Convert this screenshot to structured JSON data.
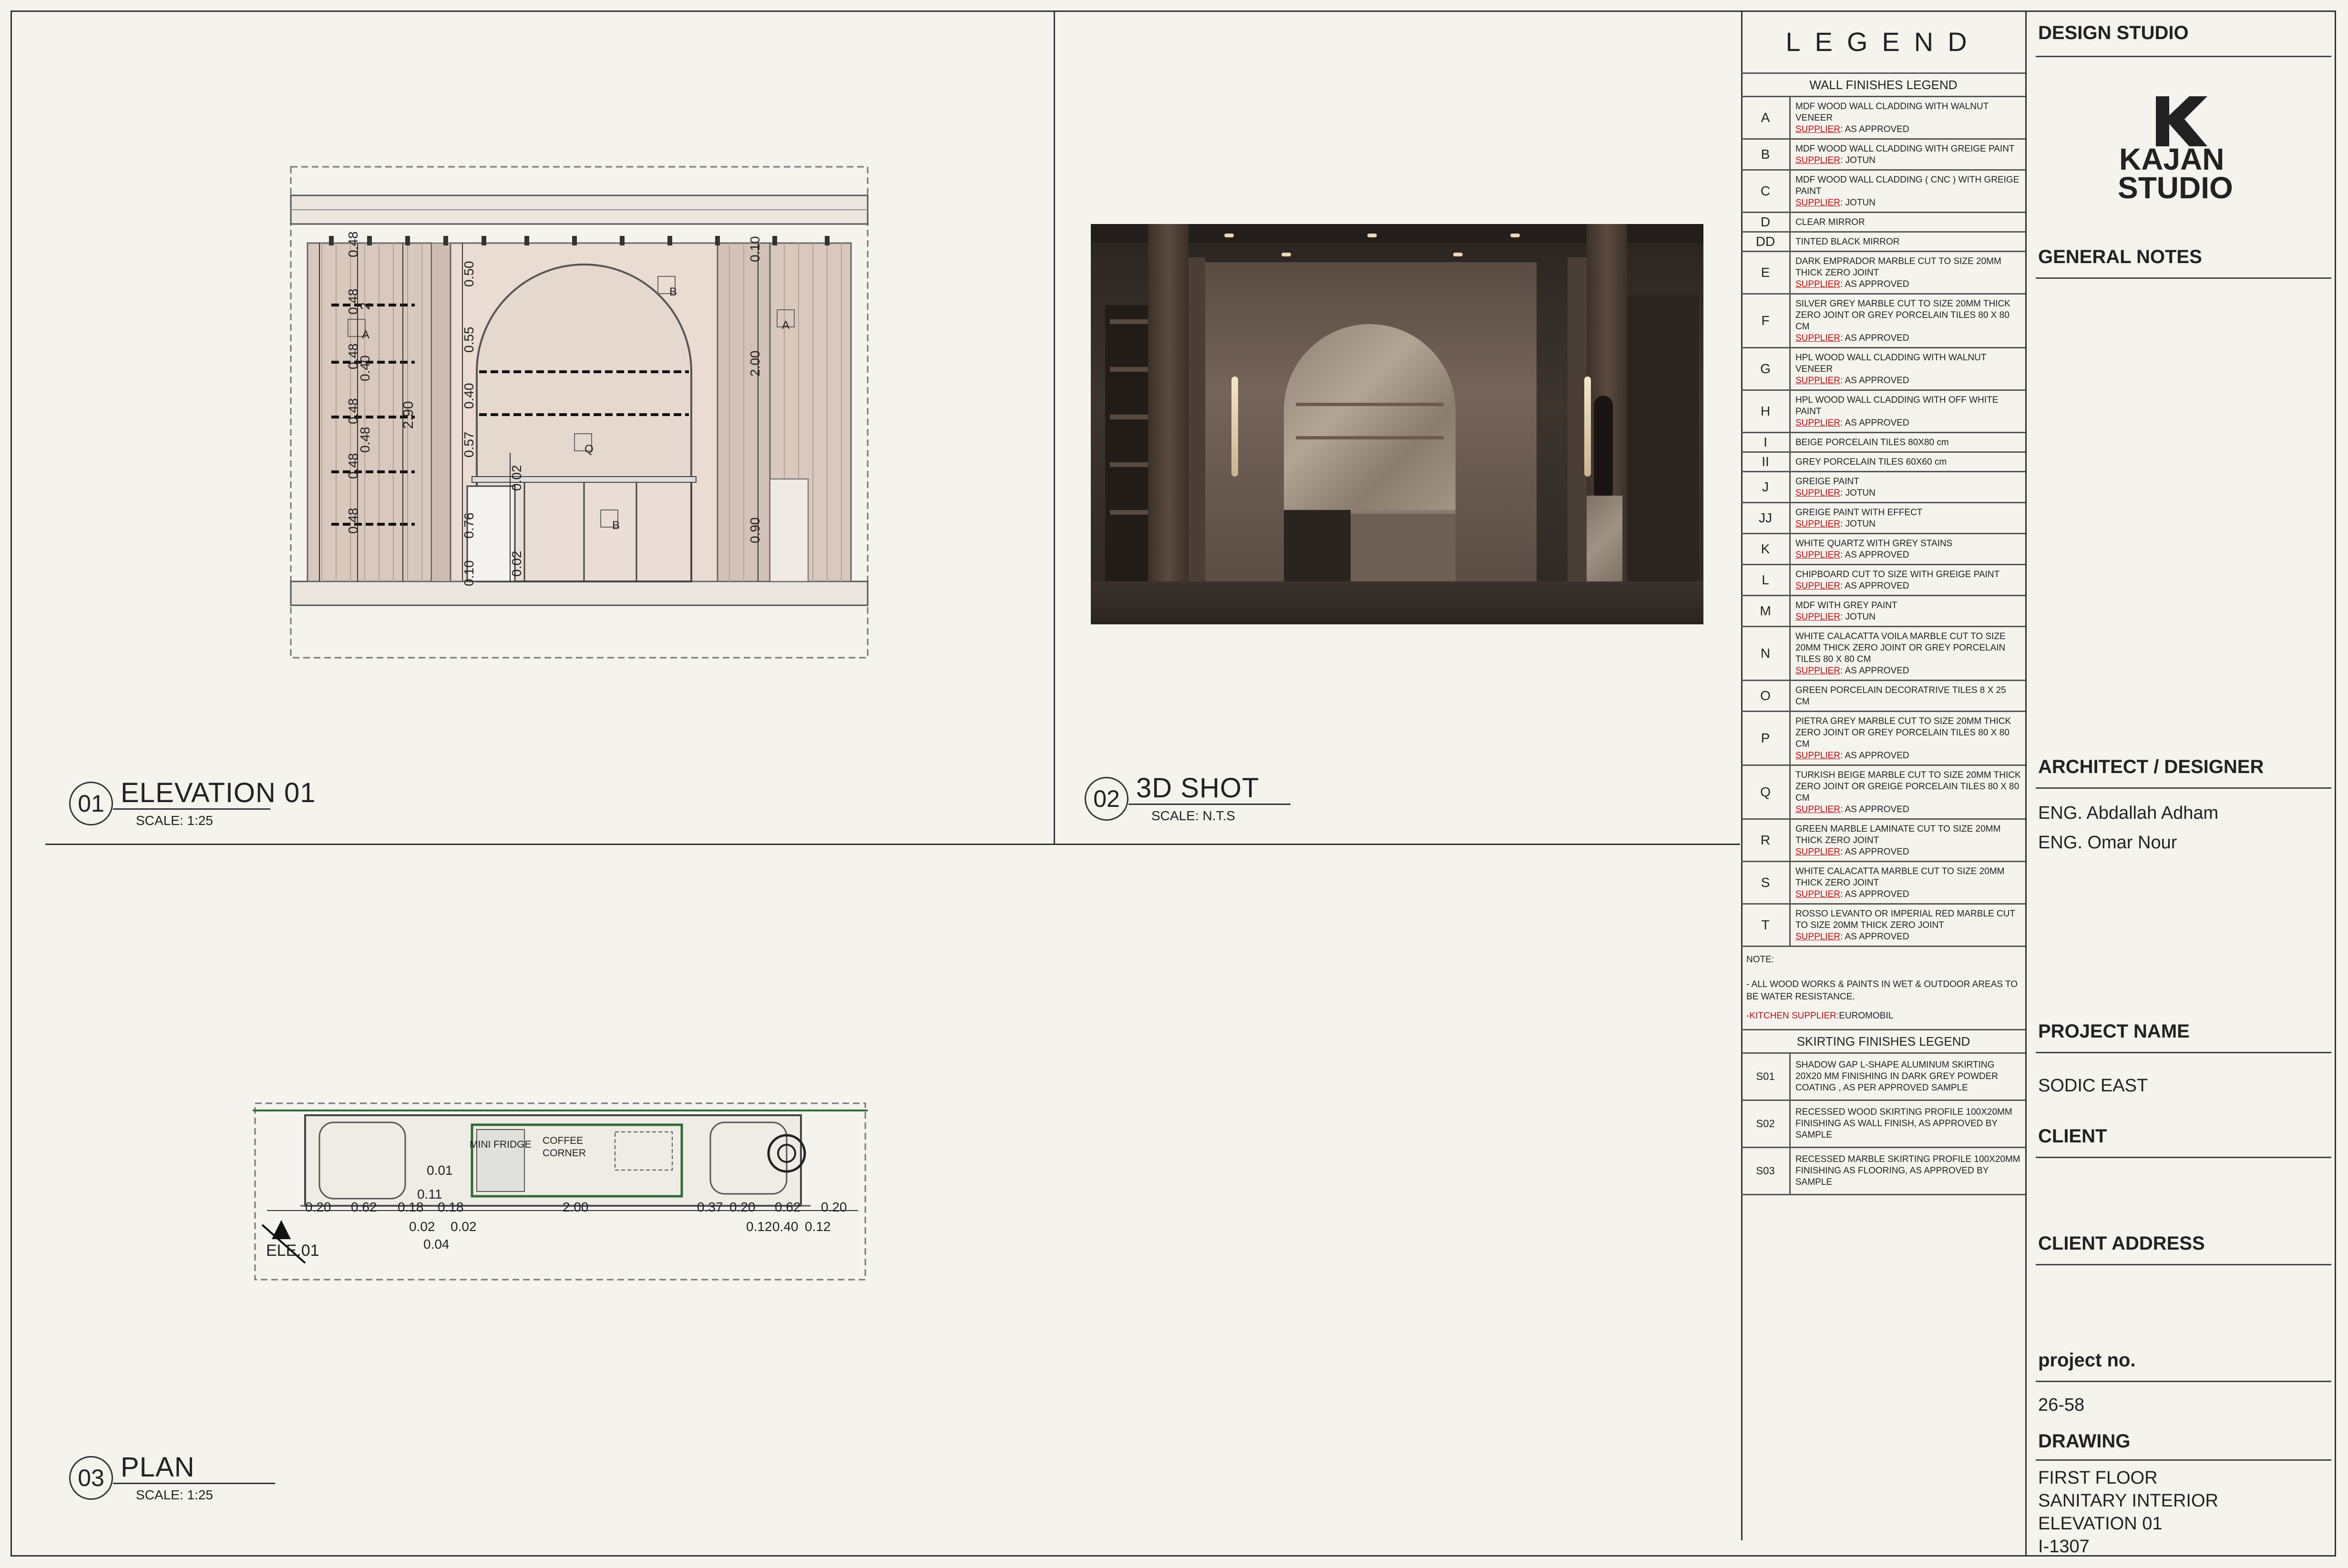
{
  "views": {
    "elevation": {
      "num": "01",
      "title": "ELEVATION 01",
      "scale": "SCALE: 1:25"
    },
    "shot": {
      "num": "02",
      "title": "3D SHOT",
      "scale": "SCALE: N.T.S"
    },
    "plan": {
      "num": "03",
      "title": "PLAN",
      "scale": "SCALE: 1:25"
    }
  },
  "elevation_dims": {
    "left_stack": [
      "0.48",
      "0.48",
      "0.48",
      "0.48",
      "0.48",
      "0.48"
    ],
    "left_mid": "0.40",
    "left_mid2": "0.48",
    "left_top2": "2",
    "overall_height": "2.90",
    "arch": [
      "0.50",
      "0.55",
      "0.40",
      "0.57",
      "0.76",
      "0.10"
    ],
    "counter": [
      "0.02",
      "0.02"
    ],
    "right": [
      "0.10",
      "2.00",
      "0.90"
    ],
    "tags": {
      "a_left": "A",
      "a_right": "A",
      "b_top": "B",
      "b_low": "B",
      "q": "Q"
    }
  },
  "plan_dims": {
    "labels": {
      "fridge": "MINI FRIDGE",
      "coffee1": "COFFEE",
      "coffee2": "CORNER",
      "ele": "ELE.01"
    },
    "row1": [
      "0.20",
      "0.62",
      "0.18",
      "0.18",
      "2.00",
      "0.37",
      "0.20",
      "0.62",
      "0.20"
    ],
    "row2": [
      "0.02",
      "0.02",
      "0.12",
      "0.40",
      "0.12"
    ],
    "misc": [
      "0.01",
      "0.11",
      "0.04"
    ]
  },
  "legend": {
    "title": "LEGEND",
    "wall_title": "WALL FINISHES LEGEND",
    "supplier_label": "SUPPLIER",
    "items": [
      {
        "code": "A",
        "desc": "MDF WOOD WALL CLADDING WITH WALNUT VENEER",
        "sup": ": AS APPROVED"
      },
      {
        "code": "B",
        "desc": "MDF WOOD WALL CLADDING WITH  GREIGE PAINT",
        "sup": ": JOTUN"
      },
      {
        "code": "C",
        "desc": "MDF WOOD WALL CLADDING ( CNC ) WITH GREIGE PAINT",
        "sup": ": JOTUN"
      },
      {
        "code": "D",
        "desc": "CLEAR MIRROR",
        "sup": ""
      },
      {
        "code": "DD",
        "desc": "TINTED BLACK MIRROR",
        "sup": ""
      },
      {
        "code": "E",
        "desc": "DARK EMPRADOR MARBLE CUT TO SIZE 20MM THICK ZERO JOINT",
        "sup": ": AS APPROVED"
      },
      {
        "code": "F",
        "desc": "SILVER GREY MARBLE CUT TO SIZE 20MM THICK ZERO JOINT OR GREY PORCELAIN TILES 80 X 80 CM",
        "sup": ": AS APPROVED"
      },
      {
        "code": "G",
        "desc": "HPL WOOD WALL CLADDING WITH WALNUT VENEER",
        "sup": ": AS APPROVED"
      },
      {
        "code": "H",
        "desc": "HPL WOOD WALL CLADDING WITH OFF WHITE PAINT",
        "sup": ": AS APPROVED"
      },
      {
        "code": "I",
        "desc": "BEIGE PORCELAIN TILES  80X80 cm",
        "sup": ""
      },
      {
        "code": "II",
        "desc": "GREY PORCELAIN TILES  60X60 cm",
        "sup": ""
      },
      {
        "code": "J",
        "desc": "GREIGE PAINT",
        "sup": ": JOTUN"
      },
      {
        "code": "JJ",
        "desc": "GREIGE PAINT WITH EFFECT",
        "sup": ": JOTUN"
      },
      {
        "code": "K",
        "desc": "WHITE QUARTZ WITH GREY STAINS",
        "sup": ": AS APPROVED"
      },
      {
        "code": "L",
        "desc": "CHIPBOARD  CUT TO SIZE WITH GREIGE PAINT",
        "sup": ": AS APPROVED"
      },
      {
        "code": "M",
        "desc": "MDF WITH GREY PAINT",
        "sup": ": JOTUN"
      },
      {
        "code": "N",
        "desc": "WHITE CALACATTA VOILA MARBLE CUT TO SIZE 20MM THICK ZERO JOINT OR GREY PORCELAIN TILES 80 X 80 CM",
        "sup": ": AS APPROVED"
      },
      {
        "code": "O",
        "desc": "GREEN PORCELAIN DECORATRIVE TILES 8 X 25 CM",
        "sup": ""
      },
      {
        "code": "P",
        "desc": "PIETRA GREY  MARBLE CUT TO SIZE 20MM THICK ZERO JOINT OR GREY PORCELAIN TILES 80 X 80 CM",
        "sup": ": AS APPROVED"
      },
      {
        "code": "Q",
        "desc": "TURKISH BEIGE MARBLE CUT TO SIZE 20MM THICK ZERO JOINT OR GREIGE PORCELAIN TILES 80 X 80 CM",
        "sup": ": AS APPROVED"
      },
      {
        "code": "R",
        "desc": "GREEN MARBLE LAMINATE CUT TO SIZE 20MM THICK ZERO JOINT",
        "sup": ": AS APPROVED"
      },
      {
        "code": "S",
        "desc": "WHITE CALACATTA MARBLE CUT TO SIZE 20MM THICK ZERO JOINT",
        "sup": ": AS APPROVED"
      },
      {
        "code": "T",
        "desc": "ROSSO LEVANTO OR IMPERIAL RED MARBLE CUT TO SIZE 20MM THICK ZERO JOINT",
        "sup": ": AS APPROVED"
      }
    ],
    "note_title": "NOTE:",
    "note_text": "- ALL WOOD WORKS & PAINTS IN WET & OUTDOOR AREAS TO BE WATER RESISTANCE.",
    "kitchen_label": "-KITCHEN SUPPLIER:",
    "kitchen_value": "EUROMOBIL",
    "skirting_title": "SKIRTING FINISHES LEGEND",
    "skirting": [
      {
        "code": "S01",
        "desc": "SHADOW GAP L-SHAPE ALUMINUM SKIRTING 20X20 MM FINISHING IN DARK GREY POWDER COATING , AS PER APPROVED SAMPLE"
      },
      {
        "code": "S02",
        "desc": "RECESSED WOOD SKIRTING PROFILE 100X20MM FINISHING AS WALL FINISH, AS APPROVED BY SAMPLE"
      },
      {
        "code": "S03",
        "desc": "RECESSED MARBLE SKIRTING PROFILE 100X20MM FINISHING AS FLOORING, AS APPROVED BY SAMPLE"
      }
    ]
  },
  "titleblock": {
    "design_studio": "DESIGN STUDIO",
    "logo_line1": "KAJAN",
    "logo_line2": "STUDIO",
    "general_notes": "GENERAL NOTES",
    "architect_label": "ARCHITECT / DESIGNER",
    "architects": [
      "ENG. Abdallah Adham",
      "ENG. Omar Nour"
    ],
    "project_label": "PROJECT NAME",
    "project_value": "SODIC EAST",
    "client_label": "CLIENT",
    "client_address_label": "CLIENT ADDRESS",
    "project_no_label": "project no.",
    "project_no": "26-58",
    "drawing_label": "DRAWING",
    "drawing_lines": [
      "FIRST FLOOR",
      "SANITARY INTERIOR",
      "ELEVATION 01",
      "I-1307"
    ]
  }
}
